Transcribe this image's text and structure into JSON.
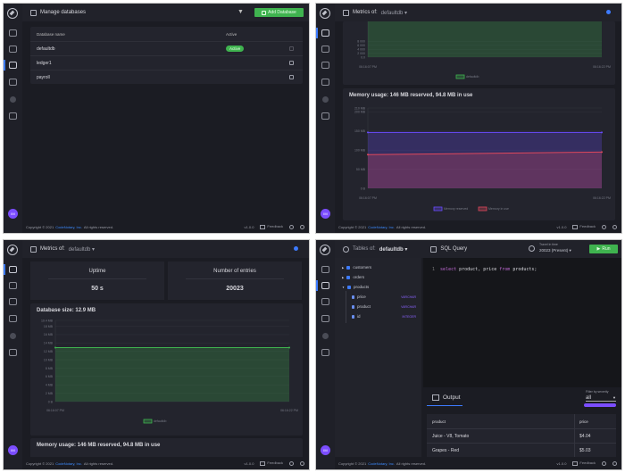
{
  "common": {
    "copyright_prefix": "Copyright © 2021",
    "company_link": "CodeNotary, Inc.",
    "copyright_suffix": "All rights reserved.",
    "version": "v1.0.0",
    "feedback": "Feedback",
    "avatar_initials": "IM",
    "metrics_of": "Metrics of:",
    "db_selected": "defaultdb",
    "accent": "#3d7bff",
    "green": "#3fb34f"
  },
  "databases": {
    "title": "Manage databases",
    "add_button": "Add Database",
    "columns": [
      "Database name",
      "Active"
    ],
    "rows": [
      {
        "name": "defaultdb",
        "active": "Active"
      },
      {
        "name": "ledger1",
        "active": ""
      },
      {
        "name": "payroll",
        "active": ""
      }
    ]
  },
  "metrics": {
    "uptime_label": "Uptime",
    "uptime_value": "50 s",
    "entries_label": "Number of entries",
    "entries_value": "20023",
    "db_size_title": "Database size: 12.9 MB",
    "memory_title": "Memory usage: 146 MB reserved, 94.8 MB in use"
  },
  "chart_data": [
    {
      "type": "area",
      "title": "Number of entries",
      "x": [
        "06:16:07 PM",
        "06:16:22 PM"
      ],
      "ylim": [
        0,
        20023
      ],
      "yticks": [
        0,
        2000,
        4000,
        6000,
        8000
      ],
      "ytick_labels": [
        "0.0",
        "2 000",
        "4 000",
        "6 000",
        "8 000"
      ],
      "series": [
        {
          "name": "defaultdb",
          "values": [
            20023,
            20023
          ],
          "color": "#3fb34f"
        }
      ],
      "legend": "bottom"
    },
    {
      "type": "area",
      "title": "Memory usage: 146 MB reserved, 94.8 MB in use",
      "x": [
        "06:16:07 PM",
        "06:16:22 PM"
      ],
      "ylim": [
        0,
        210
      ],
      "yticks": [
        0,
        50,
        100,
        150,
        200,
        210
      ],
      "ytick_labels": [
        "0 B",
        "50 MB",
        "100 MB",
        "150 MB",
        "200 MB",
        "210 MB"
      ],
      "series": [
        {
          "name": "Memory reserved",
          "values": [
            146,
            146
          ],
          "color": "#6a4cff"
        },
        {
          "name": "Memory in use",
          "values": [
            88,
            94.8
          ],
          "color": "#e0485c"
        }
      ],
      "legend": "bottom"
    },
    {
      "type": "area",
      "title": "Database size: 12.9 MB",
      "x": [
        "06:16:07 PM",
        "06:16:22 PM"
      ],
      "ylim": [
        0,
        19.4
      ],
      "yticks": [
        0,
        2,
        4,
        6,
        8,
        10,
        12,
        14,
        16,
        18,
        19.4
      ],
      "ytick_labels": [
        "0 B",
        "2 MB",
        "4 MB",
        "6 MB",
        "8 MB",
        "10 MB",
        "12 MB",
        "14 MB",
        "16 MB",
        "18 MB",
        "19.4 MB"
      ],
      "series": [
        {
          "name": "defaultdb",
          "values": [
            12.9,
            12.9
          ],
          "color": "#3fb34f"
        }
      ],
      "legend": "bottom"
    }
  ],
  "sql": {
    "tables_of": "Tables of:",
    "db": "defaultdb",
    "title": "SQL Query",
    "travel_label": "Travel in time",
    "travel_value": "20023 (Present)",
    "run_button": "Run",
    "tree": [
      {
        "name": "customers"
      },
      {
        "name": "orders"
      },
      {
        "name": "products",
        "columns": [
          {
            "name": "price",
            "type": "VARCHAR"
          },
          {
            "name": "product",
            "type": "VARCHAR"
          },
          {
            "name": "id",
            "type": "INTEGER"
          }
        ]
      }
    ],
    "line_number": "1",
    "query_kw1": "select",
    "query_mid": " product, price ",
    "query_kw2": "from",
    "query_end": " products;",
    "output_title": "Output",
    "filter_label": "Filter by severity",
    "filter_value": "all",
    "output_columns": [
      "product",
      "price"
    ],
    "output_rows": [
      {
        "product": "Juice - V8, Tomato",
        "price": "$4.04"
      },
      {
        "product": "Grapes - Red",
        "price": "$5.03"
      }
    ]
  }
}
